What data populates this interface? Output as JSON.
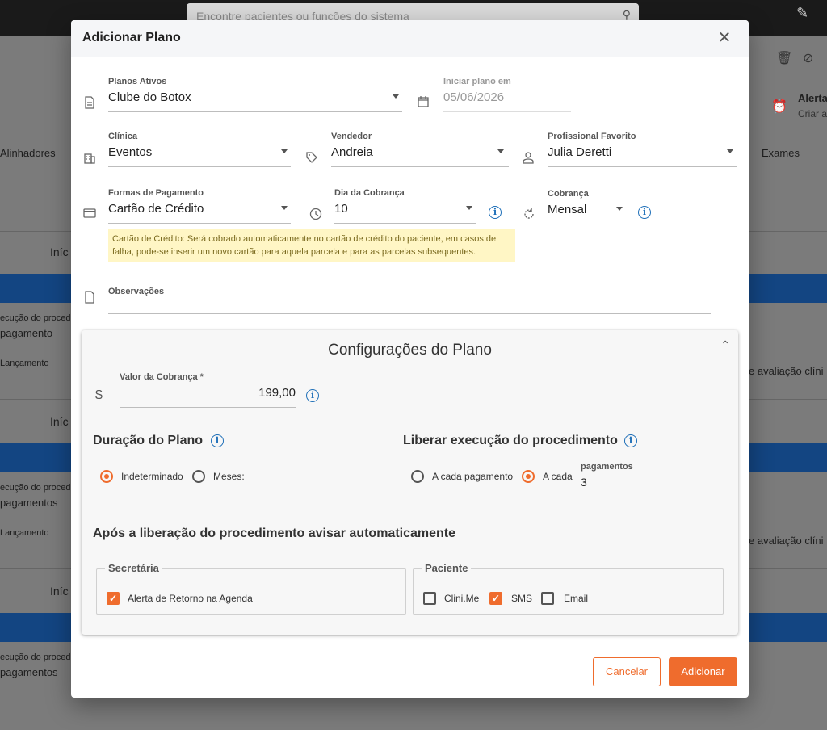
{
  "background": {
    "search_placeholder": "Encontre pacientes ou funções do sistema",
    "tabs": {
      "left": "Alinhadores",
      "right": "Exames"
    },
    "alert_title": "Alerta",
    "alert_sub": "Criar a",
    "rows": [
      {
        "start": "Iníc",
        "exec": "ecução do proced",
        "pay": "pagamento",
        "launch": "Lançamento",
        "right": "e avaliação clíni"
      },
      {
        "start": "Iníc",
        "exec": "ecução do proced",
        "pay": "pagamentos",
        "launch": "Lançamento",
        "right": "e avaliação clíni"
      },
      {
        "start": "Iníc",
        "exec": "ecução do proced",
        "pay": "pagamentos",
        "launch": "",
        "right": ""
      }
    ]
  },
  "modal": {
    "title": "Adicionar Plano",
    "planos": {
      "label": "Planos Ativos",
      "value": "Clube do Botox"
    },
    "iniciar": {
      "label": "Iniciar plano em",
      "value": "05/06/2026"
    },
    "clinica": {
      "label": "Clínica",
      "value": "Eventos"
    },
    "vendedor": {
      "label": "Vendedor",
      "value": "Andreia"
    },
    "profissional": {
      "label": "Profissional Favorito",
      "value": "Julia Deretti"
    },
    "formas": {
      "label": "Formas de Pagamento",
      "value": "Cartão de Crédito"
    },
    "dia": {
      "label": "Dia da Cobrança",
      "value": "10"
    },
    "cobranca": {
      "label": "Cobrança",
      "value": "Mensal"
    },
    "hint": "Cartão de Crédito: Será cobrado automaticamente no cartão de crédito do paciente, em casos de falha, pode-se inserir um novo cartão para aquela parcela e para as parcelas subsequentes.",
    "observacoes": {
      "label": "Observações",
      "value": ""
    },
    "config": {
      "title": "Configurações do Plano",
      "valor": {
        "label": "Valor da Cobrança *",
        "currency": "$",
        "value": "199,00"
      },
      "duracao": {
        "title": "Duração do Plano",
        "opt1": "Indeterminado",
        "opt2": "Meses:",
        "selected": "Indeterminado"
      },
      "liberar": {
        "title": "Liberar execução do procedimento",
        "opt1": "A cada pagamento",
        "opt2": "A cada",
        "pag_label": "pagamentos",
        "pag_value": "3",
        "selected": "A cada"
      },
      "avisar_title": "Após a liberação do procedimento avisar automaticamente",
      "secretaria": {
        "legend": "Secretária",
        "item": "Alerta de Retorno na Agenda",
        "checked": true
      },
      "paciente": {
        "legend": "Paciente",
        "items": [
          {
            "label": "Clini.Me",
            "checked": false
          },
          {
            "label": "SMS",
            "checked": true
          },
          {
            "label": "Email",
            "checked": false
          }
        ]
      }
    },
    "buttons": {
      "cancel": "Cancelar",
      "add": "Adicionar"
    }
  },
  "colors": {
    "accent": "#ef6c2d",
    "info": "#1e6fb8",
    "hint_bg": "#fff6c5"
  }
}
